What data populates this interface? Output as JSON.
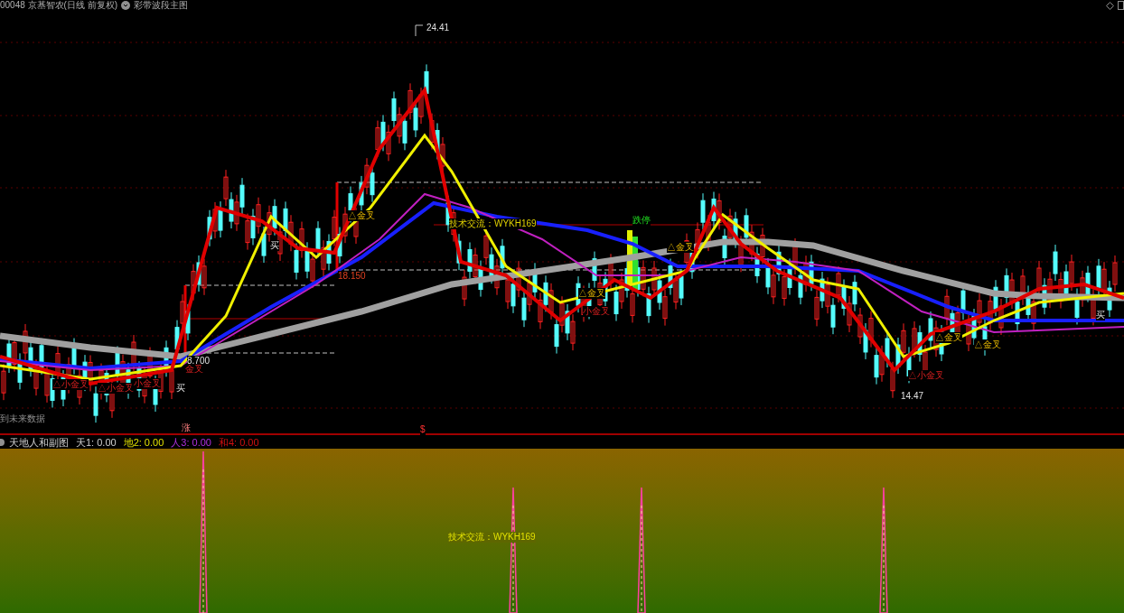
{
  "header": {
    "symbol": "00048 京基智农(日线 前复权)",
    "indicator": "彩带波段主图"
  },
  "main_chart": {
    "labels": [
      {
        "text": "24.41",
        "kind": "price"
      },
      {
        "text": "△金叉",
        "kind": "golden"
      },
      {
        "text": "技术交流：WYKH169",
        "kind": "contact"
      },
      {
        "text": "跌停",
        "kind": "limit"
      },
      {
        "text": "买",
        "kind": "buy"
      },
      {
        "text": "18.150",
        "kind": "level"
      },
      {
        "text": "△金叉",
        "kind": "golden"
      },
      {
        "text": "小金叉",
        "kind": "small"
      },
      {
        "text": "△金叉",
        "kind": "golden"
      },
      {
        "text": "8.700",
        "kind": "price"
      },
      {
        "text": "金叉",
        "kind": "small"
      },
      {
        "text": "△小金叉",
        "kind": "small"
      },
      {
        "text": "△小金叉",
        "kind": "small"
      },
      {
        "text": "小金叉",
        "kind": "small"
      },
      {
        "text": "买",
        "kind": "buy"
      },
      {
        "text": "△金叉",
        "kind": "golden"
      },
      {
        "text": "△金叉",
        "kind": "golden"
      },
      {
        "text": "△小金叉",
        "kind": "small"
      },
      {
        "text": "14.47",
        "kind": "price"
      },
      {
        "text": "买",
        "kind": "buy"
      },
      {
        "text": "到未来数据",
        "kind": "note"
      },
      {
        "text": "涨",
        "kind": "rise"
      },
      {
        "text": "$",
        "kind": "mark"
      }
    ]
  },
  "sub_chart": {
    "title": "天地人和副图",
    "values": [
      {
        "text": "天1: 0.00",
        "kind": "heaven"
      },
      {
        "text": "地2: 0.00",
        "kind": "earth"
      },
      {
        "text": "人3: 0.00",
        "kind": "human"
      },
      {
        "text": "和4: 0.00",
        "kind": "harmony"
      }
    ],
    "watermark_text": "技术交流：WYKH169"
  }
}
